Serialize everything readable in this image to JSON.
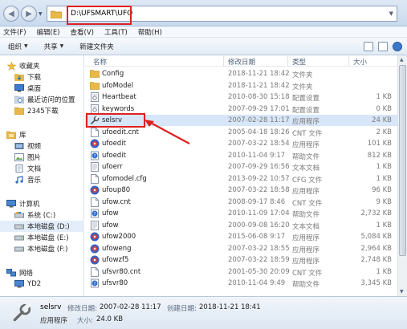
{
  "address": {
    "path": "D:\\UFSMART\\UFO"
  },
  "menu": [
    "文件(F)",
    "编辑(E)",
    "查看(V)",
    "工具(T)",
    "帮助(H)"
  ],
  "toolbar": {
    "organize": "组织",
    "share": "共享",
    "new_folder": "新建文件夹"
  },
  "nav": {
    "favorites": {
      "label": "收藏夹",
      "items": [
        "下载",
        "桌面",
        "最近访问的位置",
        "2345下载"
      ]
    },
    "libraries": {
      "label": "库",
      "items": [
        "视频",
        "图片",
        "文档",
        "音乐"
      ]
    },
    "computer": {
      "label": "计算机",
      "items": [
        "系统 (C:)",
        "本地磁盘 (D:)",
        "本地磁盘 (E:)",
        "本地磁盘 (F:)"
      ]
    },
    "network": {
      "label": "网络",
      "items": [
        "YD2"
      ]
    }
  },
  "columns": {
    "name": "名称",
    "date": "修改日期",
    "type": "类型",
    "size": "大小"
  },
  "files": [
    {
      "name": "Config",
      "date": "2018-11-21 18:42",
      "type": "文件夹",
      "size": "",
      "icon": "folder-icon"
    },
    {
      "name": "ufoModel",
      "date": "2018-11-21 18:42",
      "type": "文件夹",
      "size": "",
      "icon": "folder-icon"
    },
    {
      "name": "Heartbeat",
      "date": "2010-08-30 15:18",
      "type": "配置设置",
      "size": "1 KB",
      "icon": "config-file-icon"
    },
    {
      "name": "keywords",
      "date": "2007-09-29 17:01",
      "type": "配置设置",
      "size": "0 KB",
      "icon": "config-file-icon"
    },
    {
      "name": "selsrv",
      "date": "2007-02-28 11:17",
      "type": "应用程序",
      "size": "24 KB",
      "icon": "wrench-app-icon"
    },
    {
      "name": "ufoedit.cnt",
      "date": "2005-04-18 18:26",
      "type": "CNT 文件",
      "size": "2 KB",
      "icon": "blank-file-icon"
    },
    {
      "name": "ufoedit",
      "date": "2007-03-22 18:54",
      "type": "应用程序",
      "size": "101 KB",
      "icon": "ufo-app-icon"
    },
    {
      "name": "ufoedit",
      "date": "2010-11-04 9:17",
      "type": "帮助文件",
      "size": "812 KB",
      "icon": "help-file-icon"
    },
    {
      "name": "ufoerr",
      "date": "2007-09-29 16:56",
      "type": "文本文档",
      "size": "1 KB",
      "icon": "text-file-icon"
    },
    {
      "name": "ufomodel.cfg",
      "date": "2013-09-22 10:57",
      "type": "CFG 文件",
      "size": "1 KB",
      "icon": "blank-file-icon"
    },
    {
      "name": "ufoup80",
      "date": "2007-03-22 18:58",
      "type": "应用程序",
      "size": "96 KB",
      "icon": "ufo-app-icon"
    },
    {
      "name": "ufow.cnt",
      "date": "2008-09-17 8:46",
      "type": "CNT 文件",
      "size": "9 KB",
      "icon": "blank-file-icon"
    },
    {
      "name": "ufow",
      "date": "2010-11-09 17:04",
      "type": "帮助文件",
      "size": "2,732 KB",
      "icon": "help-file-icon"
    },
    {
      "name": "ufow",
      "date": "2000-09-08 16:20",
      "type": "文本文档",
      "size": "1 KB",
      "icon": "text-file-icon"
    },
    {
      "name": "ufow2000",
      "date": "2015-06-08 9:17",
      "type": "应用程序",
      "size": "5,084 KB",
      "icon": "ufo-app-icon"
    },
    {
      "name": "ufoweng",
      "date": "2007-03-22 18:55",
      "type": "应用程序",
      "size": "2,964 KB",
      "icon": "ufo-app-icon"
    },
    {
      "name": "ufowzf5",
      "date": "2007-03-22 18:59",
      "type": "应用程序",
      "size": "2,748 KB",
      "icon": "ufo-app-icon"
    },
    {
      "name": "ufsvr80.cnt",
      "date": "2001-05-30 20:09",
      "type": "CNT 文件",
      "size": "1 KB",
      "icon": "blank-file-icon"
    },
    {
      "name": "ufsvr80",
      "date": "2010-11-04 9:49",
      "type": "帮助文件",
      "size": "3,345 KB",
      "icon": "help-file-icon"
    }
  ],
  "details": {
    "name": "selsrv",
    "type": "应用程序",
    "modified_label": "修改日期:",
    "modified_value": "2007-02-28 11:17",
    "size_label": "大小:",
    "size_value": "24.0 KB",
    "created_label": "创建日期:",
    "created_value": "2018-11-21 18:41"
  },
  "colors": {
    "highlight": "#e02020",
    "selection": "#d7e6f8",
    "folder": "#e8b84a"
  }
}
